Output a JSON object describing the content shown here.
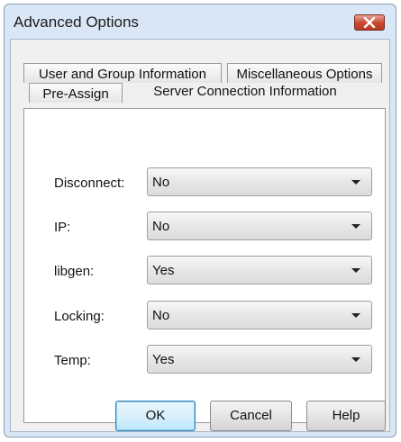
{
  "window": {
    "title": "Advanced Options"
  },
  "tabs": [
    {
      "label": "User and Group Information"
    },
    {
      "label": "Miscellaneous Options"
    },
    {
      "label": "Pre-Assign"
    },
    {
      "label": "Server Connection Information"
    }
  ],
  "fields": [
    {
      "label": "Disconnect:",
      "value": "No"
    },
    {
      "label": "IP:",
      "value": "No"
    },
    {
      "label": "libgen:",
      "value": "Yes"
    },
    {
      "label": "Locking:",
      "value": "No"
    },
    {
      "label": "Temp:",
      "value": "Yes"
    }
  ],
  "buttons": {
    "ok": "OK",
    "cancel": "Cancel",
    "help": "Help"
  },
  "icons": {
    "close": "close-icon",
    "dropdown": "chevron-down-icon"
  },
  "colors": {
    "title_bar": "#d9e6f5",
    "close_button": "#c9462e",
    "default_button": "#bee6fd"
  }
}
